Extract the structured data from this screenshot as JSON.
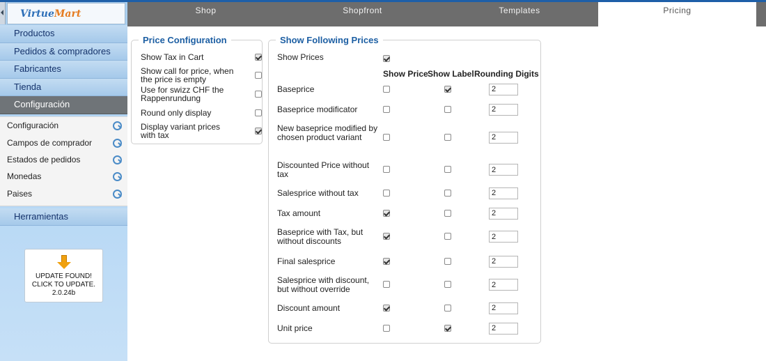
{
  "logo": {
    "part1": "Virtue",
    "part2": "Mart"
  },
  "sidebar": {
    "menu": [
      "Productos",
      "Pedidos & compradores",
      "Fabricantes",
      "Tienda",
      "Configuración"
    ],
    "submenu": [
      "Configuración",
      "Campos de comprador",
      "Estados de pedidos",
      "Monedas",
      "Paises"
    ],
    "tools": "Herramientas",
    "update": {
      "line1": "UPDATE FOUND!",
      "line2": "CLICK TO UPDATE.",
      "line3": "2.0.24b"
    }
  },
  "tabs": [
    "Shop",
    "Shopfront",
    "Templates",
    "Pricing"
  ],
  "price_config": {
    "legend": "Price Configuration",
    "items": [
      {
        "label": "Show Tax in Cart",
        "checked": true
      },
      {
        "label": "Show call for price, when the price is empty",
        "checked": false
      },
      {
        "label": "Use for swizz CHF the Rappenrundung",
        "checked": false
      },
      {
        "label": "Round only display",
        "checked": false
      },
      {
        "label": "Display variant prices with tax",
        "checked": true
      }
    ]
  },
  "show_prices": {
    "legend": "Show Following Prices",
    "show_prices_label": "Show Prices",
    "show_prices_checked": true,
    "col_show_price": "Show Price",
    "col_show_label": "Show Label",
    "col_rounding": "Rounding Digits",
    "rows": [
      {
        "label": "Baseprice",
        "show_price": false,
        "show_label": true,
        "rounding": "2"
      },
      {
        "label": "Baseprice modificator",
        "show_price": false,
        "show_label": false,
        "rounding": "2"
      },
      {
        "label": "New baseprice modified by chosen product variant",
        "show_price": false,
        "show_label": false,
        "rounding": "2"
      },
      {
        "label": "Discounted Price without tax",
        "show_price": false,
        "show_label": false,
        "rounding": "2"
      },
      {
        "label": "Salesprice without tax",
        "show_price": false,
        "show_label": false,
        "rounding": "2"
      },
      {
        "label": "Tax amount",
        "show_price": true,
        "show_label": false,
        "rounding": "2"
      },
      {
        "label": "Baseprice with Tax, but without discounts",
        "show_price": true,
        "show_label": false,
        "rounding": "2"
      },
      {
        "label": "Final salesprice",
        "show_price": true,
        "show_label": false,
        "rounding": "2"
      },
      {
        "label": "Salesprice with discount, but without override",
        "show_price": false,
        "show_label": false,
        "rounding": "2"
      },
      {
        "label": "Discount amount",
        "show_price": true,
        "show_label": false,
        "rounding": "2"
      },
      {
        "label": "Unit price",
        "show_price": false,
        "show_label": true,
        "rounding": "2"
      }
    ]
  }
}
